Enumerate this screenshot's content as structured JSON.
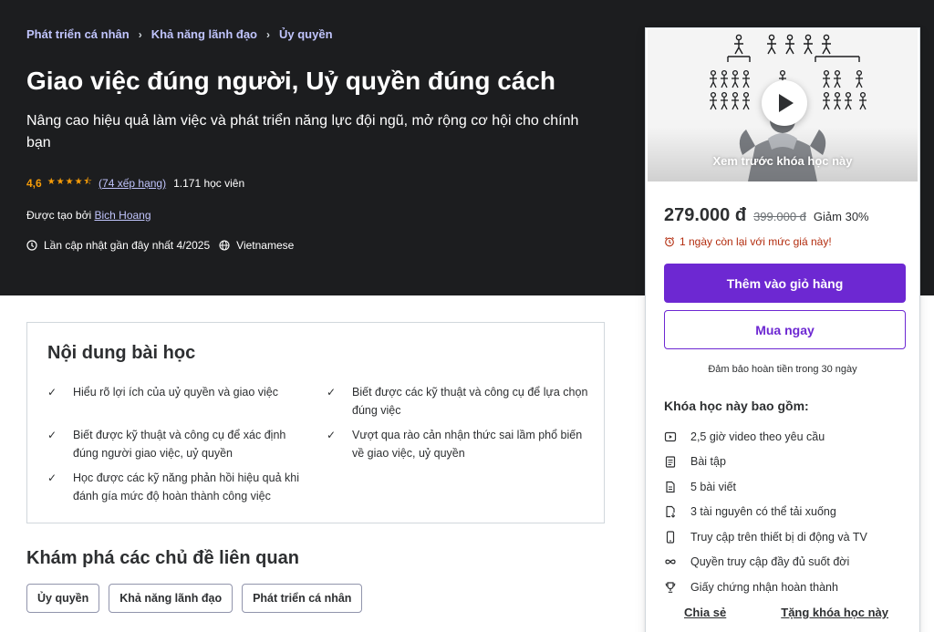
{
  "breadcrumb": [
    "Phát triển cá nhân",
    "Khả năng lãnh đạo",
    "Ủy quyền"
  ],
  "course": {
    "title": "Giao việc đúng người, Uỷ quyền đúng cách",
    "subtitle": "Nâng cao hiệu quả làm việc và phát triển năng lực đội ngũ, mở rộng cơ hội cho chính bạn",
    "rating": "4,6",
    "rating_stars": 4.5,
    "rating_count": "(74 xếp hạng)",
    "students": "1.171 học viên",
    "created_by_label": "Được tạo bởi",
    "author": "Bich Hoang",
    "last_updated": "Lần cập nhật gần đây nhất 4/2025",
    "language": "Vietnamese"
  },
  "sidebar": {
    "preview_label": "Xem trước khóa học này",
    "price": "279.000 đ",
    "old_price": "399.000 đ",
    "discount": "Giảm 30%",
    "countdown": "1 ngày còn lại với mức giá này!",
    "add_to_cart": "Thêm vào giỏ hàng",
    "buy_now": "Mua ngay",
    "guarantee": "Đảm bảo hoàn tiền trong 30 ngày",
    "includes_title": "Khóa học này bao gồm:",
    "includes": [
      {
        "icon": "video-icon",
        "label": "2,5 giờ video theo yêu cầu"
      },
      {
        "icon": "assignment-icon",
        "label": "Bài tập"
      },
      {
        "icon": "article-icon",
        "label": "5 bài viết"
      },
      {
        "icon": "download-icon",
        "label": "3 tài nguyên có thể tải xuống"
      },
      {
        "icon": "mobile-icon",
        "label": "Truy cập trên thiết bị di động và TV"
      },
      {
        "icon": "infinity-icon",
        "label": "Quyền truy cập đầy đủ suốt đời"
      },
      {
        "icon": "trophy-icon",
        "label": "Giấy chứng nhận hoàn thành"
      }
    ],
    "share": "Chia sẻ",
    "gift": "Tặng khóa học này"
  },
  "learn": {
    "title": "Nội dung bài học",
    "items": [
      "Hiểu rõ lợi ích của uỷ quyền và giao việc",
      "Biết được các kỹ thuật và công cụ để lựa chọn đúng việc",
      "Biết được kỹ thuật và công cụ để xác định đúng người giao việc, uỷ quyền",
      "Vượt qua rào cản nhận thức sai lầm phổ biến về giao việc, uỷ quyền",
      "Học được các kỹ năng phản hồi hiệu quả khi đánh gía mức độ hoàn thành công việc"
    ]
  },
  "topics": {
    "title": "Khám phá các chủ đề liên quan",
    "items": [
      "Ủy quyền",
      "Khả năng lãnh đạo",
      "Phát triển cá nhân"
    ]
  },
  "colors": {
    "hero_bg": "#1c1d1f",
    "link_purple": "#c0c4fc",
    "accent_purple": "#6d28d2",
    "star": "#f69c08",
    "alert_red": "#b32d0f"
  }
}
